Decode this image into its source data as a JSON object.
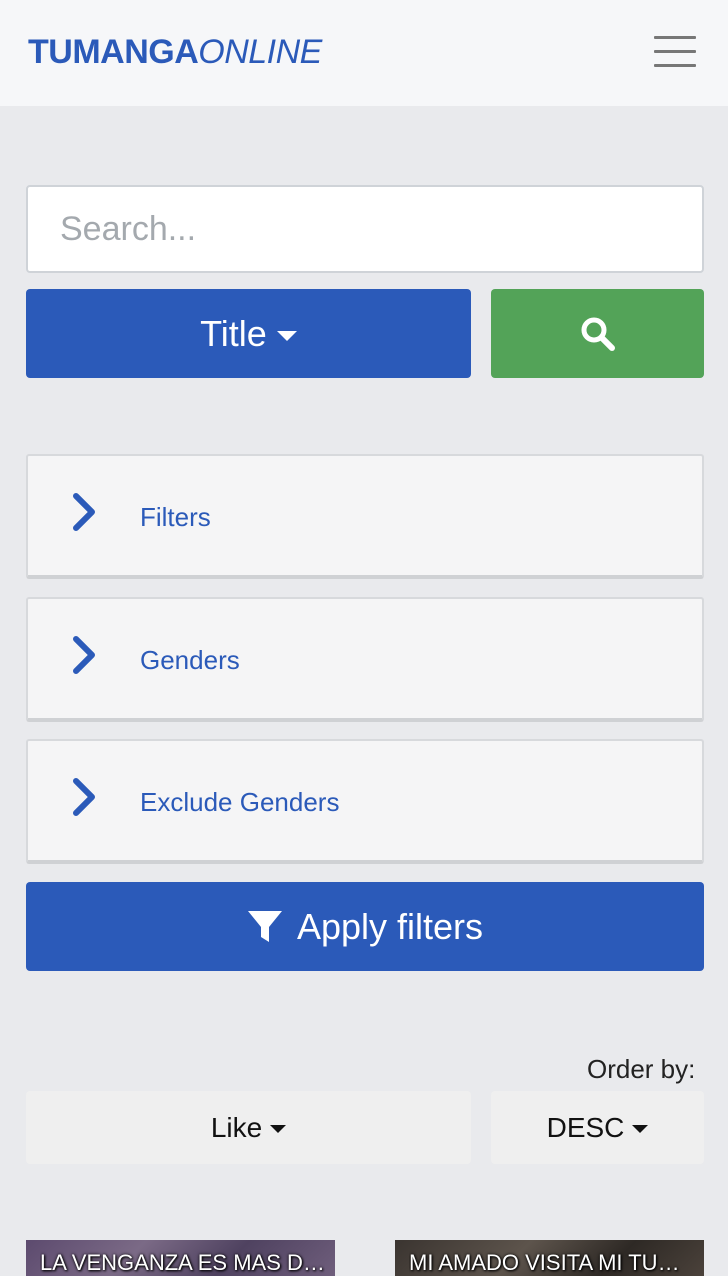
{
  "navbar": {
    "brand_part1": "TUMANGA",
    "brand_part2": "ONLINE",
    "menu_icon": "hamburger-icon"
  },
  "search": {
    "placeholder": "Search...",
    "value": "",
    "type_button_label": "Title",
    "search_icon": "search-icon"
  },
  "panels": [
    {
      "label": "Filters",
      "icon": "chevron-right-icon"
    },
    {
      "label": "Genders",
      "icon": "chevron-right-icon"
    },
    {
      "label": "Exclude Genders",
      "icon": "chevron-right-icon"
    }
  ],
  "apply_button": {
    "label": "Apply filters",
    "icon": "filter-icon"
  },
  "order": {
    "label": "Order by:",
    "field_selected": "Like",
    "direction_selected": "DESC"
  },
  "cards": [
    {
      "title": "LA VENGANZA ES MAS DULCE"
    },
    {
      "title": "MI AMADO VISITA MI TUMBA"
    }
  ],
  "colors": {
    "primary": "#2b5ab9",
    "success": "#53a358",
    "background": "#e9eaed",
    "navbar": "#f6f7f9"
  }
}
